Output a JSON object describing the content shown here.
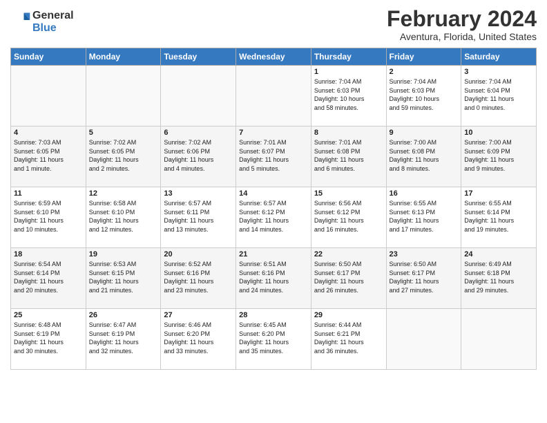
{
  "header": {
    "logo_line1": "General",
    "logo_line2": "Blue",
    "month": "February 2024",
    "location": "Aventura, Florida, United States"
  },
  "weekdays": [
    "Sunday",
    "Monday",
    "Tuesday",
    "Wednesday",
    "Thursday",
    "Friday",
    "Saturday"
  ],
  "weeks": [
    [
      {
        "day": "",
        "info": ""
      },
      {
        "day": "",
        "info": ""
      },
      {
        "day": "",
        "info": ""
      },
      {
        "day": "",
        "info": ""
      },
      {
        "day": "1",
        "info": "Sunrise: 7:04 AM\nSunset: 6:03 PM\nDaylight: 10 hours\nand 58 minutes."
      },
      {
        "day": "2",
        "info": "Sunrise: 7:04 AM\nSunset: 6:03 PM\nDaylight: 10 hours\nand 59 minutes."
      },
      {
        "day": "3",
        "info": "Sunrise: 7:04 AM\nSunset: 6:04 PM\nDaylight: 11 hours\nand 0 minutes."
      }
    ],
    [
      {
        "day": "4",
        "info": "Sunrise: 7:03 AM\nSunset: 6:05 PM\nDaylight: 11 hours\nand 1 minute."
      },
      {
        "day": "5",
        "info": "Sunrise: 7:02 AM\nSunset: 6:05 PM\nDaylight: 11 hours\nand 2 minutes."
      },
      {
        "day": "6",
        "info": "Sunrise: 7:02 AM\nSunset: 6:06 PM\nDaylight: 11 hours\nand 4 minutes."
      },
      {
        "day": "7",
        "info": "Sunrise: 7:01 AM\nSunset: 6:07 PM\nDaylight: 11 hours\nand 5 minutes."
      },
      {
        "day": "8",
        "info": "Sunrise: 7:01 AM\nSunset: 6:08 PM\nDaylight: 11 hours\nand 6 minutes."
      },
      {
        "day": "9",
        "info": "Sunrise: 7:00 AM\nSunset: 6:08 PM\nDaylight: 11 hours\nand 8 minutes."
      },
      {
        "day": "10",
        "info": "Sunrise: 7:00 AM\nSunset: 6:09 PM\nDaylight: 11 hours\nand 9 minutes."
      }
    ],
    [
      {
        "day": "11",
        "info": "Sunrise: 6:59 AM\nSunset: 6:10 PM\nDaylight: 11 hours\nand 10 minutes."
      },
      {
        "day": "12",
        "info": "Sunrise: 6:58 AM\nSunset: 6:10 PM\nDaylight: 11 hours\nand 12 minutes."
      },
      {
        "day": "13",
        "info": "Sunrise: 6:57 AM\nSunset: 6:11 PM\nDaylight: 11 hours\nand 13 minutes."
      },
      {
        "day": "14",
        "info": "Sunrise: 6:57 AM\nSunset: 6:12 PM\nDaylight: 11 hours\nand 14 minutes."
      },
      {
        "day": "15",
        "info": "Sunrise: 6:56 AM\nSunset: 6:12 PM\nDaylight: 11 hours\nand 16 minutes."
      },
      {
        "day": "16",
        "info": "Sunrise: 6:55 AM\nSunset: 6:13 PM\nDaylight: 11 hours\nand 17 minutes."
      },
      {
        "day": "17",
        "info": "Sunrise: 6:55 AM\nSunset: 6:14 PM\nDaylight: 11 hours\nand 19 minutes."
      }
    ],
    [
      {
        "day": "18",
        "info": "Sunrise: 6:54 AM\nSunset: 6:14 PM\nDaylight: 11 hours\nand 20 minutes."
      },
      {
        "day": "19",
        "info": "Sunrise: 6:53 AM\nSunset: 6:15 PM\nDaylight: 11 hours\nand 21 minutes."
      },
      {
        "day": "20",
        "info": "Sunrise: 6:52 AM\nSunset: 6:16 PM\nDaylight: 11 hours\nand 23 minutes."
      },
      {
        "day": "21",
        "info": "Sunrise: 6:51 AM\nSunset: 6:16 PM\nDaylight: 11 hours\nand 24 minutes."
      },
      {
        "day": "22",
        "info": "Sunrise: 6:50 AM\nSunset: 6:17 PM\nDaylight: 11 hours\nand 26 minutes."
      },
      {
        "day": "23",
        "info": "Sunrise: 6:50 AM\nSunset: 6:17 PM\nDaylight: 11 hours\nand 27 minutes."
      },
      {
        "day": "24",
        "info": "Sunrise: 6:49 AM\nSunset: 6:18 PM\nDaylight: 11 hours\nand 29 minutes."
      }
    ],
    [
      {
        "day": "25",
        "info": "Sunrise: 6:48 AM\nSunset: 6:19 PM\nDaylight: 11 hours\nand 30 minutes."
      },
      {
        "day": "26",
        "info": "Sunrise: 6:47 AM\nSunset: 6:19 PM\nDaylight: 11 hours\nand 32 minutes."
      },
      {
        "day": "27",
        "info": "Sunrise: 6:46 AM\nSunset: 6:20 PM\nDaylight: 11 hours\nand 33 minutes."
      },
      {
        "day": "28",
        "info": "Sunrise: 6:45 AM\nSunset: 6:20 PM\nDaylight: 11 hours\nand 35 minutes."
      },
      {
        "day": "29",
        "info": "Sunrise: 6:44 AM\nSunset: 6:21 PM\nDaylight: 11 hours\nand 36 minutes."
      },
      {
        "day": "",
        "info": ""
      },
      {
        "day": "",
        "info": ""
      }
    ]
  ]
}
